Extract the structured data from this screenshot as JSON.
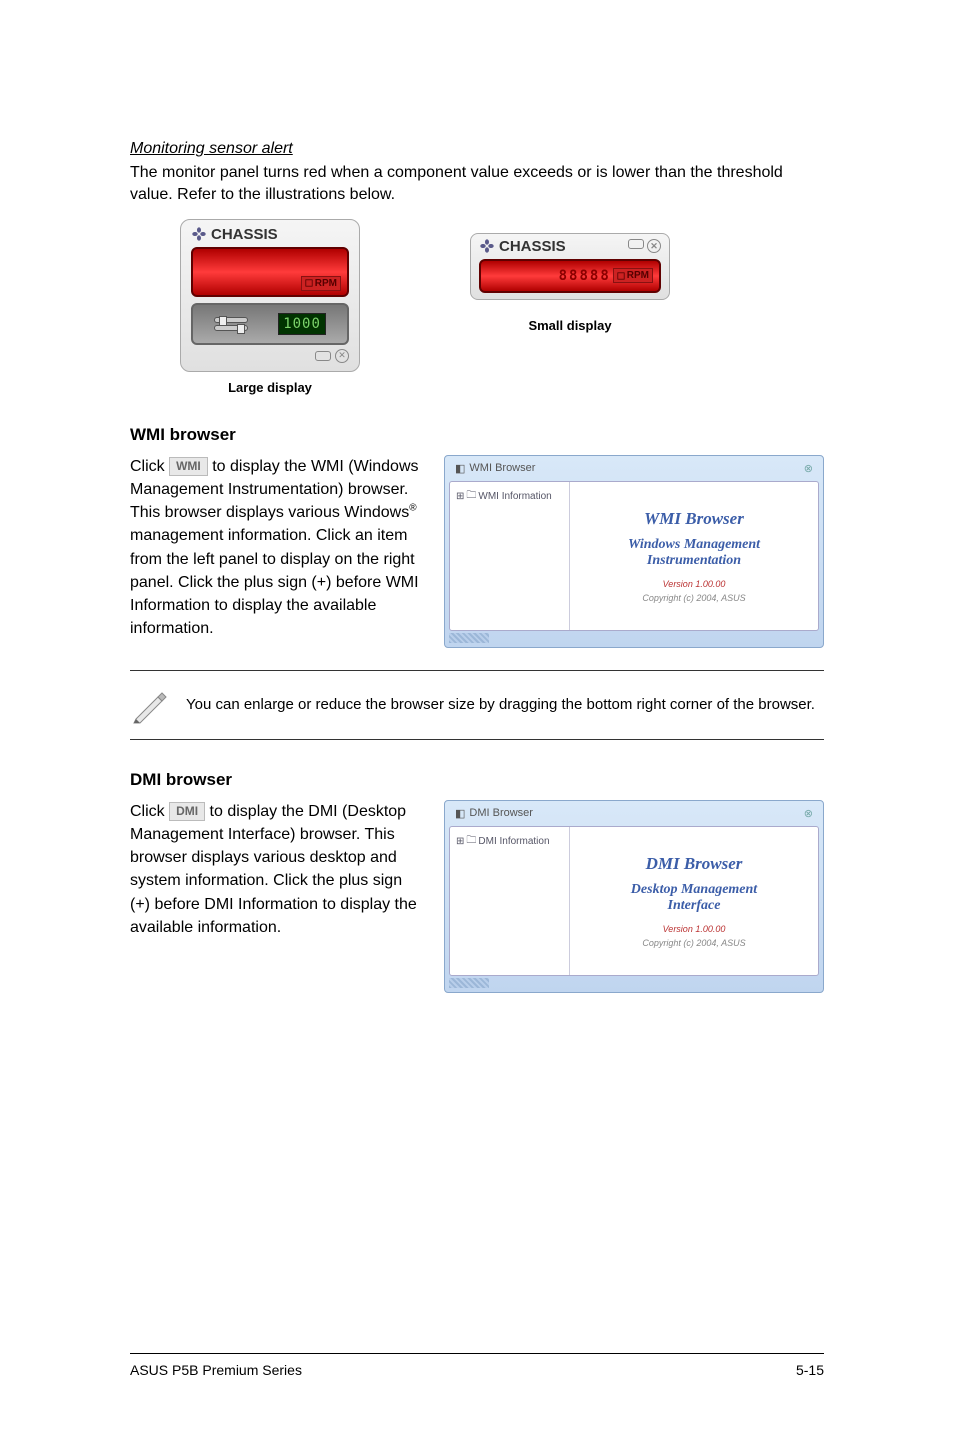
{
  "monitoring": {
    "heading": "Monitoring sensor alert",
    "description": "The monitor panel turns red when a component value exceeds or is lower than the threshold value. Refer to the illustrations below."
  },
  "large_panel": {
    "title": "CHASSIS",
    "rpm_label": "RPM",
    "display_value": "1000",
    "caption": "Large display"
  },
  "small_panel": {
    "title": "CHASSIS",
    "digits": "88888",
    "rpm_label": "RPM",
    "caption": "Small display"
  },
  "wmi": {
    "heading": "WMI browser",
    "text_before_icon": "Click ",
    "icon_label": "WMI",
    "text_after_icon": " to display the WMI (Windows Management Instrumentation) browser. This browser displays various Windows",
    "superscript": "®",
    "text_continued": " management information. Click an item from the left panel to display on the right panel. Click the plus sign (+) before WMI Information to display the available information."
  },
  "wmi_window": {
    "title": "WMI Browser",
    "tree_root": "WMI Information",
    "content_title": "WMI  Browser",
    "content_sub1": "Windows Management",
    "content_sub2": "Instrumentation",
    "version": "Version 1.00.00",
    "copyright": "Copyright (c) 2004,  ASUS"
  },
  "note": {
    "text": "You can enlarge or reduce the browser size by dragging the bottom right corner of the browser."
  },
  "dmi": {
    "heading": "DMI browser",
    "text_before_icon": "Click ",
    "icon_label": "DMI",
    "text_after_icon": " to display the DMI (Desktop Management Interface) browser. This browser displays various desktop and system information. Click the plus sign (+) before DMI Information to display the available information."
  },
  "dmi_window": {
    "title": "DMI Browser",
    "tree_root": "DMI Information",
    "content_title": "DMI  Browser",
    "content_sub1": "Desktop Management",
    "content_sub2": "Interface",
    "version": "Version 1.00.00",
    "copyright": "Copyright (c) 2004,  ASUS"
  },
  "footer": {
    "left": "ASUS P5B Premium Series",
    "right": "5-15"
  }
}
